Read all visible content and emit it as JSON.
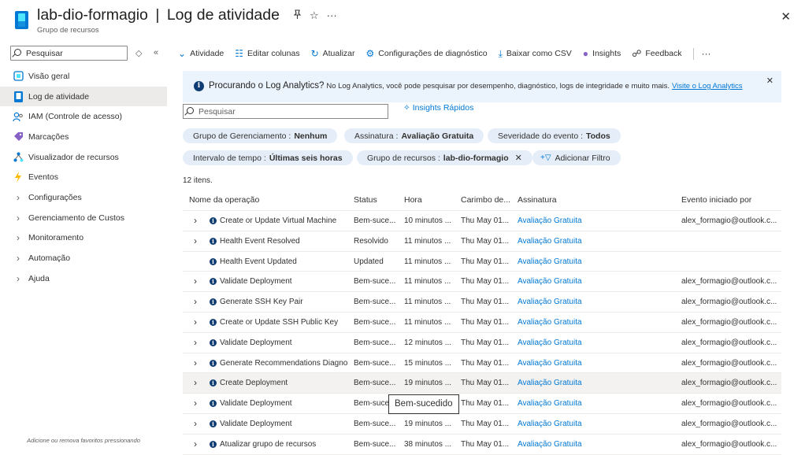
{
  "header": {
    "resource_name": "lab-dio-formagio",
    "separator": "|",
    "page_name": "Log de atividade",
    "subtitle": "Grupo de recursos",
    "pin_icon": "pin-icon",
    "star_icon": "star-icon",
    "more_icon": "ellipsis-icon",
    "close_icon": "close-icon"
  },
  "sidebar": {
    "search_placeholder": "Pesquisar",
    "items": [
      {
        "label": "Visão geral",
        "icon": "overview-icon",
        "active": false,
        "expandable": false
      },
      {
        "label": "Log de atividade",
        "icon": "activity-log-icon",
        "active": true,
        "expandable": false
      },
      {
        "label": "IAM (Controle de acesso)",
        "icon": "iam-icon",
        "active": false,
        "expandable": false
      },
      {
        "label": "Marcações",
        "icon": "tag-icon",
        "active": false,
        "expandable": false
      },
      {
        "label": "Visualizador de recursos",
        "icon": "resource-visualizer-icon",
        "active": false,
        "expandable": false
      },
      {
        "label": "Eventos",
        "icon": "events-icon",
        "active": false,
        "expandable": false
      },
      {
        "label": "Configurações",
        "icon": "chevron-right-icon",
        "active": false,
        "expandable": true
      },
      {
        "label": "Gerenciamento de Custos",
        "icon": "chevron-right-icon",
        "active": false,
        "expandable": true
      },
      {
        "label": "Monitoramento",
        "icon": "chevron-right-icon",
        "active": false,
        "expandable": true
      },
      {
        "label": "Automação",
        "icon": "chevron-right-icon",
        "active": false,
        "expandable": true
      },
      {
        "label": "Ajuda",
        "icon": "chevron-right-icon",
        "active": false,
        "expandable": true
      }
    ],
    "footer": "Adicione ou remova favoritos pressionando"
  },
  "toolbar": {
    "activity": "Atividade",
    "edit_columns": "Editar colunas",
    "refresh": "Atualizar",
    "diagnostic": "Configurações de diagnóstico",
    "download_csv": "Baixar como CSV",
    "insights": "Insights",
    "feedback": "Feedback",
    "more": "···"
  },
  "banner": {
    "title": "Procurando o Log Analytics?",
    "description": "No Log Analytics, você pode pesquisar por desempenho, diagnóstico, logs de integridade e muito mais.",
    "link": "Visite o Log Analytics"
  },
  "filters": {
    "search_placeholder": "Pesquisar",
    "quick_insights": "Insights Rápidos",
    "pills": [
      {
        "key": "Grupo de Gerenciamento :",
        "value": "Nenhum",
        "removable": false
      },
      {
        "key": "Assinatura :",
        "value": "Avaliação Gratuita",
        "removable": false
      },
      {
        "key": "Severidade do evento :",
        "value": "Todos",
        "removable": false
      },
      {
        "key": "Intervalo de tempo :",
        "value": "Últimas seis horas",
        "removable": false
      },
      {
        "key": "Grupo de recursos :",
        "value": "lab-dio-formagio",
        "removable": true
      }
    ],
    "add_filter": "Adicionar Filtro"
  },
  "count_text": "12 itens.",
  "table": {
    "columns": [
      "Nome da operação",
      "Status",
      "Hora",
      "Carimbo de...",
      "Assinatura",
      "Evento iniciado por"
    ],
    "rows": [
      {
        "expandable": true,
        "operation": "Create or Update Virtual Machine",
        "status": "Bem-suce...",
        "time": "10 minutos ...",
        "timestamp": "Thu May 01...",
        "subscription": "Avaliação Gratuita",
        "initiated_by": "alex_formagio@outlook.c..."
      },
      {
        "expandable": true,
        "operation": "Health Event Resolved",
        "status": "Resolvido",
        "time": "11 minutos ...",
        "timestamp": "Thu May 01...",
        "subscription": "Avaliação Gratuita",
        "initiated_by": ""
      },
      {
        "expandable": false,
        "operation": "Health Event Updated",
        "status": "Updated",
        "time": "11 minutos ...",
        "timestamp": "Thu May 01...",
        "subscription": "Avaliação Gratuita",
        "initiated_by": ""
      },
      {
        "expandable": true,
        "operation": "Validate Deployment",
        "status": "Bem-suce...",
        "time": "11 minutos ...",
        "timestamp": "Thu May 01...",
        "subscription": "Avaliação Gratuita",
        "initiated_by": "alex_formagio@outlook.c..."
      },
      {
        "expandable": true,
        "operation": "Generate SSH Key Pair",
        "status": "Bem-suce...",
        "time": "11 minutos ...",
        "timestamp": "Thu May 01...",
        "subscription": "Avaliação Gratuita",
        "initiated_by": "alex_formagio@outlook.c..."
      },
      {
        "expandable": true,
        "operation": "Create or Update SSH Public Key",
        "status": "Bem-suce...",
        "time": "11 minutos ...",
        "timestamp": "Thu May 01...",
        "subscription": "Avaliação Gratuita",
        "initiated_by": "alex_formagio@outlook.c..."
      },
      {
        "expandable": true,
        "operation": "Validate Deployment",
        "status": "Bem-suce...",
        "time": "12 minutos ...",
        "timestamp": "Thu May 01...",
        "subscription": "Avaliação Gratuita",
        "initiated_by": "alex_formagio@outlook.c..."
      },
      {
        "expandable": true,
        "operation": "Generate Recommendations Diagnostics",
        "status": "Bem-suce...",
        "time": "15 minutos ...",
        "timestamp": "Thu May 01...",
        "subscription": "Avaliação Gratuita",
        "initiated_by": "alex_formagio@outlook.c..."
      },
      {
        "expandable": true,
        "operation": "Create Deployment",
        "status": "Bem-suce...",
        "time": "19 minutos ...",
        "timestamp": "Thu May 01...",
        "subscription": "Avaliação Gratuita",
        "initiated_by": "alex_formagio@outlook.c...",
        "highlighted": true
      },
      {
        "expandable": true,
        "operation": "Validate Deployment",
        "status": "Bem-suce...",
        "time": "19 minutos ...",
        "timestamp": "Thu May 01...",
        "subscription": "Avaliação Gratuita",
        "initiated_by": "alex_formagio@outlook.c..."
      },
      {
        "expandable": true,
        "operation": "Validate Deployment",
        "status": "Bem-suce...",
        "time": "19 minutos ...",
        "timestamp": "Thu May 01...",
        "subscription": "Avaliação Gratuita",
        "initiated_by": "alex_formagio@outlook.c..."
      },
      {
        "expandable": true,
        "operation": "Atualizar grupo de recursos",
        "status": "Bem-suce...",
        "time": "38 minutos ...",
        "timestamp": "Thu May 01...",
        "subscription": "Avaliação Gratuita",
        "initiated_by": "alex_formagio@outlook.c..."
      }
    ]
  },
  "tooltip": "Bem-sucedido",
  "colors": {
    "accent": "#0078d4",
    "banner_bg": "#ebf3fc",
    "pill_bg": "#e5eef8",
    "info_icon": "#0f3d73",
    "selected_bg": "#edebe9"
  }
}
